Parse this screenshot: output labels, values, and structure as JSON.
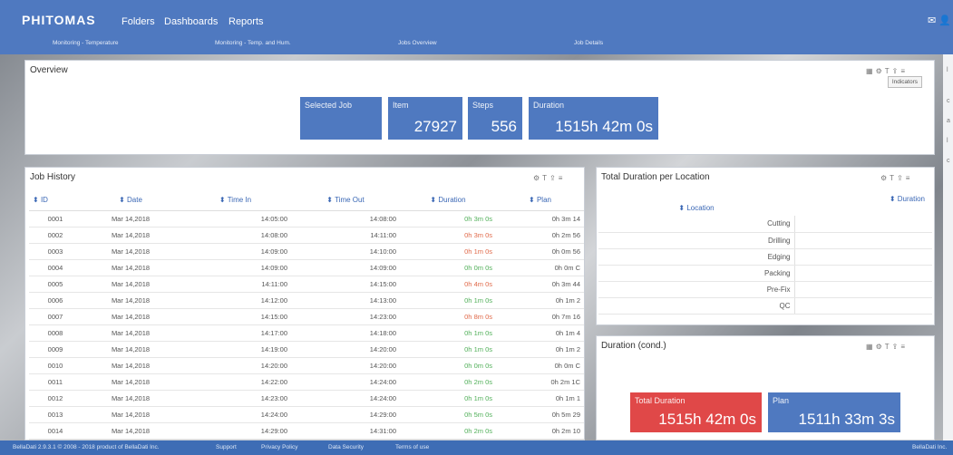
{
  "header": {
    "logo": "PHITOMAS",
    "nav": [
      "Folders",
      "Dashboards",
      "Reports"
    ],
    "subnav": [
      "Monitoring - Temperature",
      "Monitoring - Temp. and Hum.",
      "Jobs Overview",
      "Job Details"
    ]
  },
  "overview": {
    "title": "Overview",
    "indicators_label": "Indicators",
    "kpis": {
      "selected_job": "Selected Job",
      "item_label": "Item",
      "item_value": "27927",
      "steps_label": "Steps",
      "steps_value": "556",
      "duration_label": "Duration",
      "duration_value": "1515h 42m 0s"
    }
  },
  "job_history": {
    "title": "Job History",
    "columns": [
      "ID",
      "Date",
      "Time In",
      "Time Out",
      "Duration",
      "Plan"
    ],
    "rows": [
      [
        "0001",
        "Mar 14,2018",
        "14:05:00",
        "14:08:00",
        "0h 3m 0s",
        "0h 3m 14"
      ],
      [
        "0002",
        "Mar 14,2018",
        "14:08:00",
        "14:11:00",
        "0h 3m 0s",
        "0h 2m 56"
      ],
      [
        "0003",
        "Mar 14,2018",
        "14:09:00",
        "14:10:00",
        "0h 1m 0s",
        "0h 0m 56"
      ],
      [
        "0004",
        "Mar 14,2018",
        "14:09:00",
        "14:09:00",
        "0h 0m 0s",
        "0h 0m C"
      ],
      [
        "0005",
        "Mar 14,2018",
        "14:11:00",
        "14:15:00",
        "0h 4m 0s",
        "0h 3m 44"
      ],
      [
        "0006",
        "Mar 14,2018",
        "14:12:00",
        "14:13:00",
        "0h 1m 0s",
        "0h 1m 2"
      ],
      [
        "0007",
        "Mar 14,2018",
        "14:15:00",
        "14:23:00",
        "0h 8m 0s",
        "0h 7m 16"
      ],
      [
        "0008",
        "Mar 14,2018",
        "14:17:00",
        "14:18:00",
        "0h 1m 0s",
        "0h 1m 4"
      ],
      [
        "0009",
        "Mar 14,2018",
        "14:19:00",
        "14:20:00",
        "0h 1m 0s",
        "0h 1m 2"
      ],
      [
        "0010",
        "Mar 14,2018",
        "14:20:00",
        "14:20:00",
        "0h 0m 0s",
        "0h 0m C"
      ],
      [
        "0011",
        "Mar 14,2018",
        "14:22:00",
        "14:24:00",
        "0h 2m 0s",
        "0h 2m 1C"
      ],
      [
        "0012",
        "Mar 14,2018",
        "14:23:00",
        "14:24:00",
        "0h 1m 0s",
        "0h 1m 1"
      ],
      [
        "0013",
        "Mar 14,2018",
        "14:24:00",
        "14:29:00",
        "0h 5m 0s",
        "0h 5m 29"
      ],
      [
        "0014",
        "Mar 14,2018",
        "14:29:00",
        "14:31:00",
        "0h 2m 0s",
        "0h 2m 10"
      ]
    ],
    "duration_colors": [
      "green",
      "red",
      "red",
      "green",
      "red",
      "green",
      "red",
      "green",
      "green",
      "green",
      "green",
      "green",
      "green",
      "green"
    ]
  },
  "location": {
    "title": "Total Duration per Location",
    "col_location": "Location",
    "col_duration": "Duration",
    "rows": [
      "Cutting",
      "Drilling",
      "Edging",
      "Packing",
      "Pre-Fix",
      "QC"
    ]
  },
  "duration_cond": {
    "title": "Duration (cond.)",
    "total_label": "Total Duration",
    "total_value": "1515h 42m 0s",
    "plan_label": "Plan",
    "plan_value": "1511h 33m 3s"
  },
  "footer": {
    "copyright": "BellaDati 2.9.3.1 © 2008 - 2018 product of BellaDati Inc.",
    "links": [
      "Support",
      "Privacy Policy",
      "Data Security",
      "Terms of use"
    ],
    "brand": "BellaDati Inc."
  },
  "colors": {
    "accent": "#4f79c0",
    "danger": "#e04848",
    "good": "#52b05a",
    "bad": "#e06a4a"
  }
}
